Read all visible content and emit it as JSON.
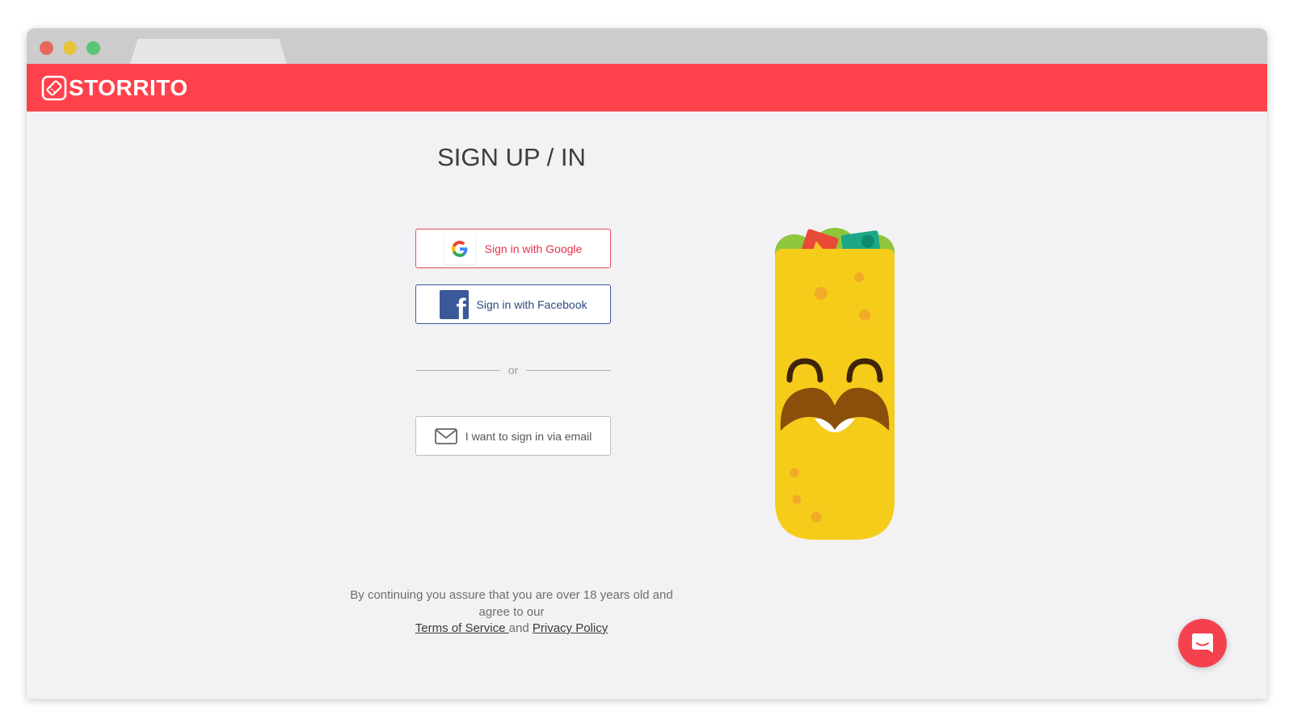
{
  "window": {
    "traffic_lights": [
      "close",
      "minimize",
      "maximize"
    ]
  },
  "header": {
    "brand": "STORRITO",
    "brand_color": "#fe414b",
    "logo_icon": "ticket-icon"
  },
  "page": {
    "title": "SIGN UP / IN"
  },
  "auth": {
    "google_label": "Sign in with Google",
    "facebook_label": "Sign in with Facebook",
    "divider_text": "or",
    "email_label": "I want to sign in via email"
  },
  "disclaimer": {
    "text": "By continuing you assure that you are over 18 years old and agree to our",
    "terms_link": "Terms of Service ",
    "and": "and",
    "privacy_link": "Privacy Policy"
  },
  "mascot": {
    "icon": "burrito-mascot-icon"
  },
  "chat": {
    "icon": "chat-bubble-icon",
    "color": "#f5414e"
  },
  "colors": {
    "google_red": "#e8304a",
    "facebook_blue": "#3b5998",
    "page_bg": "#f2f2f5"
  }
}
